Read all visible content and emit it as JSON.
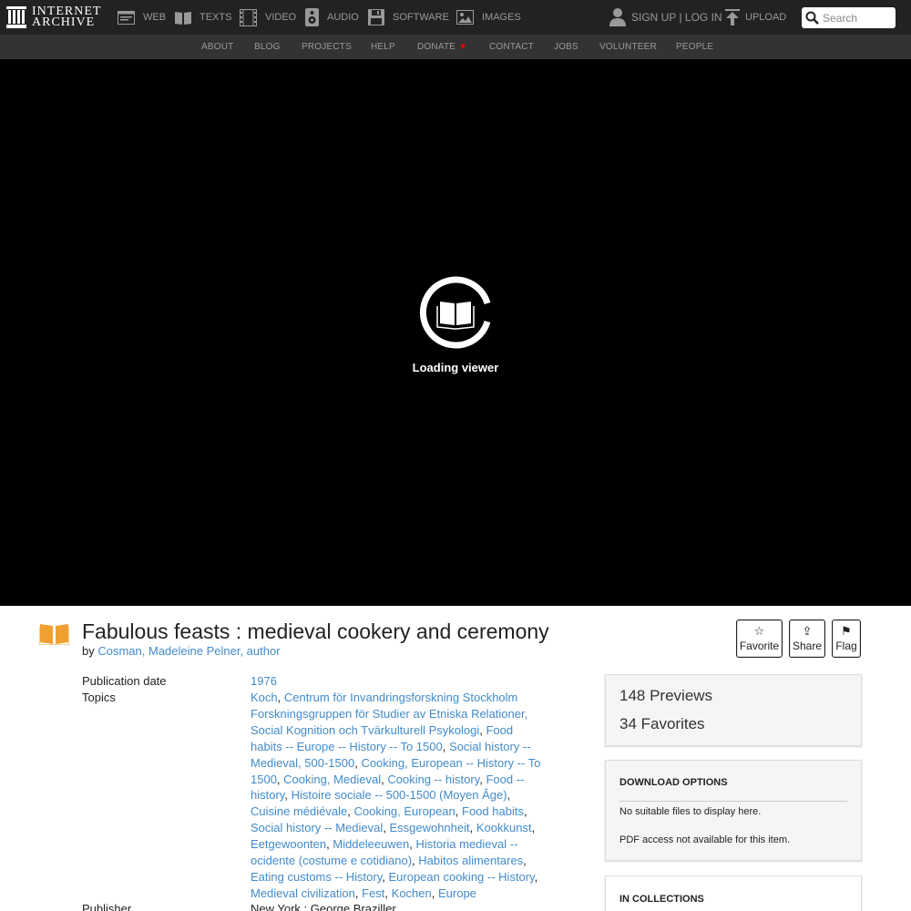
{
  "nav": {
    "logo_line1": "INTERNET",
    "logo_line2": "ARCHIVE",
    "items": [
      {
        "label": "WEB",
        "icon": "web-icon"
      },
      {
        "label": "TEXTS",
        "icon": "book-icon"
      },
      {
        "label": "VIDEO",
        "icon": "film-icon"
      },
      {
        "label": "AUDIO",
        "icon": "speaker-icon"
      },
      {
        "label": "SOFTWARE",
        "icon": "floppy-icon"
      },
      {
        "label": "IMAGES",
        "icon": "image-icon"
      }
    ],
    "signup": "SIGN UP | LOG IN",
    "upload": "UPLOAD",
    "search_placeholder": "Search"
  },
  "subnav": {
    "items": [
      "ABOUT",
      "BLOG",
      "PROJECTS",
      "HELP",
      "DONATE",
      "CONTACT",
      "JOBS",
      "VOLUNTEER",
      "PEOPLE"
    ],
    "heart": "♥"
  },
  "viewer": {
    "loading_text": "Loading viewer"
  },
  "item": {
    "title": "Fabulous feasts : medieval cookery and ceremony",
    "by_label": "by",
    "author": "Cosman, Madeleine Pelner, author",
    "actions": [
      {
        "label": "Favorite",
        "glyph": "☆"
      },
      {
        "label": "Share",
        "glyph": "⇪"
      },
      {
        "label": "Flag",
        "glyph": "⚑"
      }
    ],
    "metadata": {
      "pubdate_label": "Publication date",
      "pubdate_value": "1976",
      "topics_label": "Topics",
      "topics": [
        "Koch",
        "Centrum för Invandringsforskning Stockholm Forskningsgruppen för Studier av Etniska Relationer, Social Kognition och Tvärkulturell Psykologi",
        "Food habits -- Europe -- History -- To 1500",
        "Social history -- Medieval, 500-1500",
        "Cooking, European -- History -- To 1500",
        "Cooking, Medieval",
        "Cooking -- history",
        "Food -- history",
        "Histoire sociale -- 500-1500 (Moyen Âge)",
        "Cuisine médiévale",
        "Cooking, European",
        "Food habits",
        "Social history -- Medieval",
        "Essgewohnheit",
        "Kookkunst",
        "Eetgewoonten",
        "Middeleeuwen",
        "Historia medieval -- ocidente (costume e cotidiano)",
        "Habitos alimentares",
        "Eating customs -- History",
        "European cooking -- History",
        "Medieval civilization",
        "Fest",
        "Kochen",
        "Europe"
      ],
      "publisher_label": "Publisher",
      "publisher_value": "New York : George Braziller"
    }
  },
  "sidebar": {
    "previews": "148 Previews",
    "favorites": "34 Favorites",
    "download_title": "DOWNLOAD OPTIONS",
    "download_msg1": "No suitable files to display here.",
    "download_msg2": "PDF access not available for this item.",
    "collections_title": "IN COLLECTIONS"
  },
  "colors": {
    "topnav_bg": "#222222",
    "subnav_bg": "#333333",
    "link": "#428bca",
    "texts_icon": "#f0a030",
    "donate_heart": "#ee0000"
  }
}
